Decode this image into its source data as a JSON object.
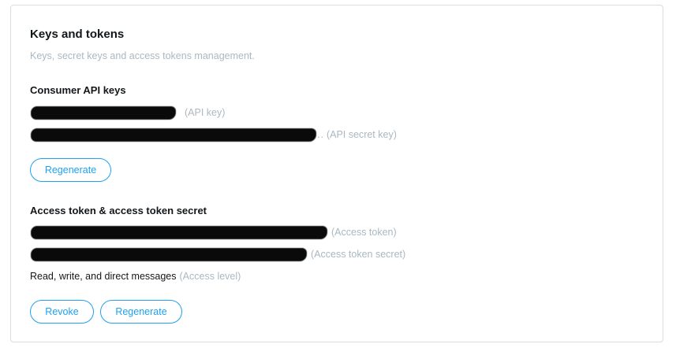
{
  "card": {
    "title": "Keys and tokens",
    "subtitle": "Keys, secret keys and access tokens management."
  },
  "consumer": {
    "title": "Consumer API keys",
    "api_key_hint": "(API key)",
    "api_secret_dots": "..",
    "api_secret_hint": "(API secret key)",
    "regenerate_label": "Regenerate"
  },
  "access": {
    "title": "Access token & access token secret",
    "token_hint": "(Access token)",
    "secret_hint": "(Access token secret)",
    "level_value": "Read, write, and direct messages",
    "level_hint": "(Access level)",
    "revoke_label": "Revoke",
    "regenerate_label": "Regenerate"
  },
  "colors": {
    "accent": "#1da1f2",
    "muted": "#aab8c2",
    "text": "#14171a",
    "border": "#d7dde2"
  }
}
